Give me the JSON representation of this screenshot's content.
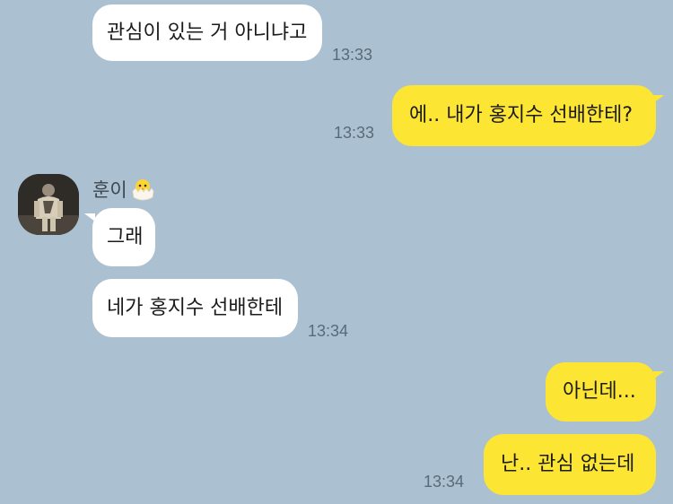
{
  "messages": [
    {
      "side": "in",
      "text": "관심이 있는 거 아니냐고",
      "time": "13:33"
    },
    {
      "side": "out",
      "text": "에.. 내가 홍지수 선배한테?",
      "time": "13:33"
    },
    {
      "side": "in",
      "text": "그래",
      "time": ""
    },
    {
      "side": "in",
      "text": "네가 홍지수 선배한테",
      "time": "13:34"
    },
    {
      "side": "out",
      "text": "아닌데...",
      "time": ""
    },
    {
      "side": "out",
      "text": "난.. 관심 없는데",
      "time": "13:34"
    }
  ],
  "sender": {
    "name": "훈이",
    "badge_icon": "hatching-chick-icon",
    "avatar_icon": "profile-photo-avatar"
  },
  "colors": {
    "background": "#abc1d1",
    "incoming_bubble": "#ffffff",
    "outgoing_bubble": "#fde533",
    "timestamp": "#5a6a78"
  }
}
